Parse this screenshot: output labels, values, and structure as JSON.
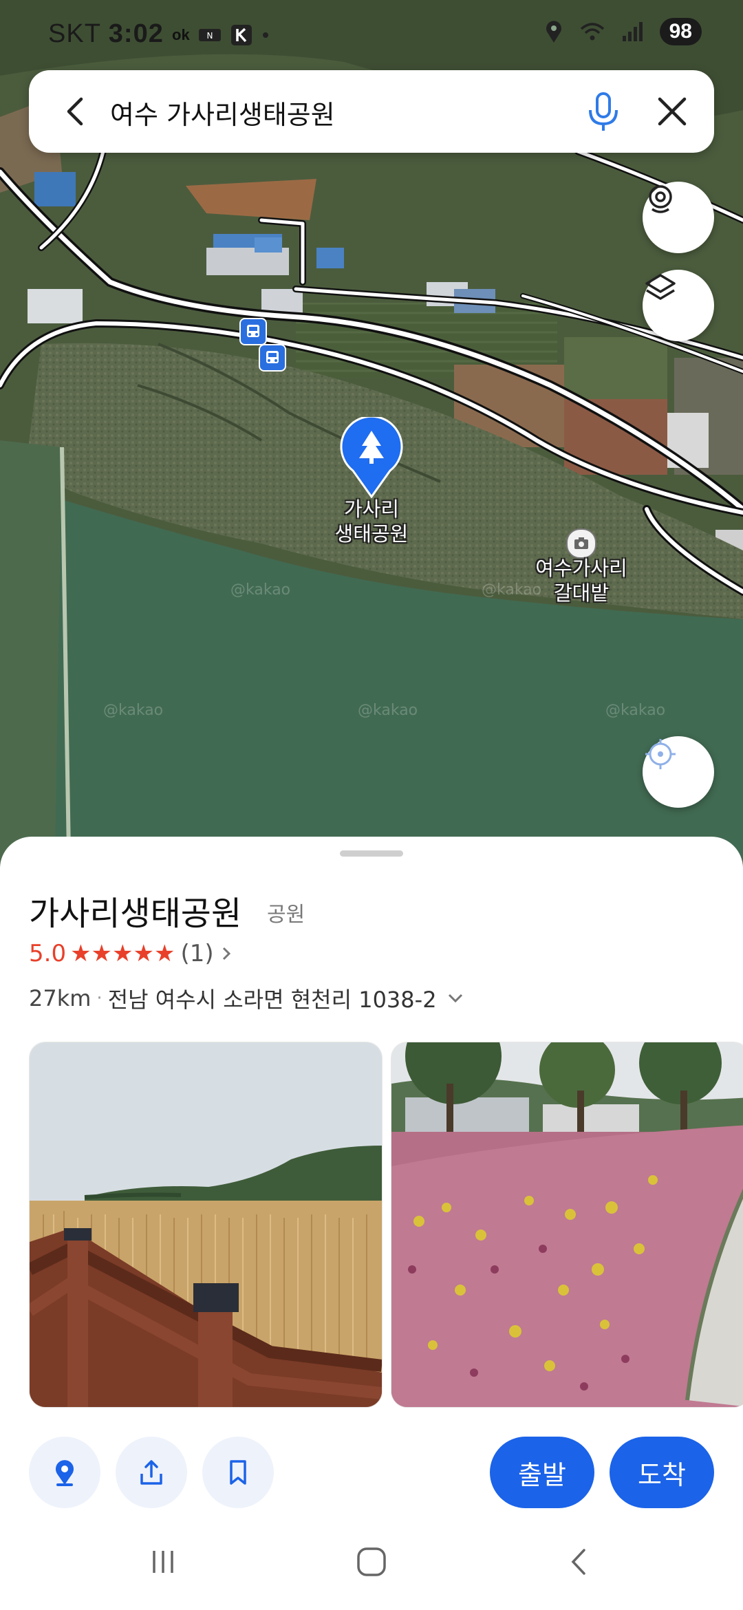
{
  "status": {
    "carrier": "SKT",
    "time": "3:02",
    "battery": "98",
    "icons": [
      "ok-cashbag-icon",
      "nfc-icon",
      "k-app-icon",
      "dot-icon",
      "location-icon",
      "wifi-icon",
      "signal-icon"
    ]
  },
  "search": {
    "query": "여수 가사리생태공원"
  },
  "map": {
    "pin_label_line1": "가사리",
    "pin_label_line2": "생태공원",
    "poi_label_line1": "여수가사리",
    "poi_label_line2": "갈대밭",
    "watermark": "@kakao"
  },
  "place": {
    "name": "가사리생태공원",
    "category": "공원",
    "rating": "5.0",
    "stars": "★★★★★",
    "review_count": "(1)",
    "distance": "27km",
    "address": "전남 여수시 소라면 현천리 1038-2"
  },
  "actions": {
    "depart": "출발",
    "arrive": "도착"
  },
  "colors": {
    "accent": "#1b63e8",
    "rating": "#e8402a",
    "sheet_bg": "#ffffff"
  }
}
